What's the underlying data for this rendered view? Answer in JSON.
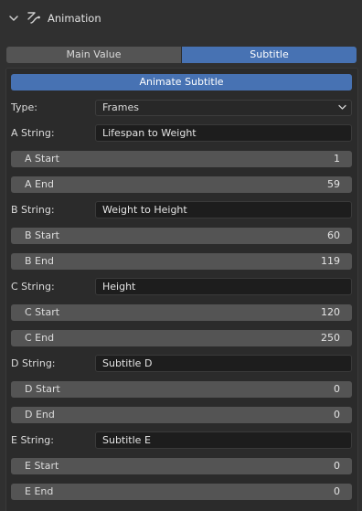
{
  "header": {
    "title": "Animation",
    "expand_icon": "chevron-down-icon",
    "section_icon": "fcurve-icon"
  },
  "tabs": [
    {
      "label": "Main Value",
      "active": false
    },
    {
      "label": "Subtitle",
      "active": true
    }
  ],
  "animate_button": {
    "label": "Animate Subtitle"
  },
  "type_row": {
    "label": "Type:",
    "value": "Frames"
  },
  "rows": [
    {
      "string_label": "A String:",
      "string_value": "Lifespan to Weight",
      "start_label": "A Start",
      "start_value": "1",
      "end_label": "A End",
      "end_value": "59"
    },
    {
      "string_label": "B String:",
      "string_value": "Weight to Height",
      "start_label": "B Start",
      "start_value": "60",
      "end_label": "B End",
      "end_value": "119"
    },
    {
      "string_label": "C String:",
      "string_value": "Height",
      "start_label": "C Start",
      "start_value": "120",
      "end_label": "C End",
      "end_value": "250"
    },
    {
      "string_label": "D String:",
      "string_value": "Subtitle D",
      "start_label": "D Start",
      "start_value": "0",
      "end_label": "D End",
      "end_value": "0"
    },
    {
      "string_label": "E String:",
      "string_value": "Subtitle E",
      "start_label": "E Start",
      "start_value": "0",
      "end_label": "E End",
      "end_value": "0"
    }
  ],
  "colors": {
    "accent": "#4772b3",
    "background": "#303030",
    "panel": "#2b2b2b",
    "field": "#545454"
  }
}
